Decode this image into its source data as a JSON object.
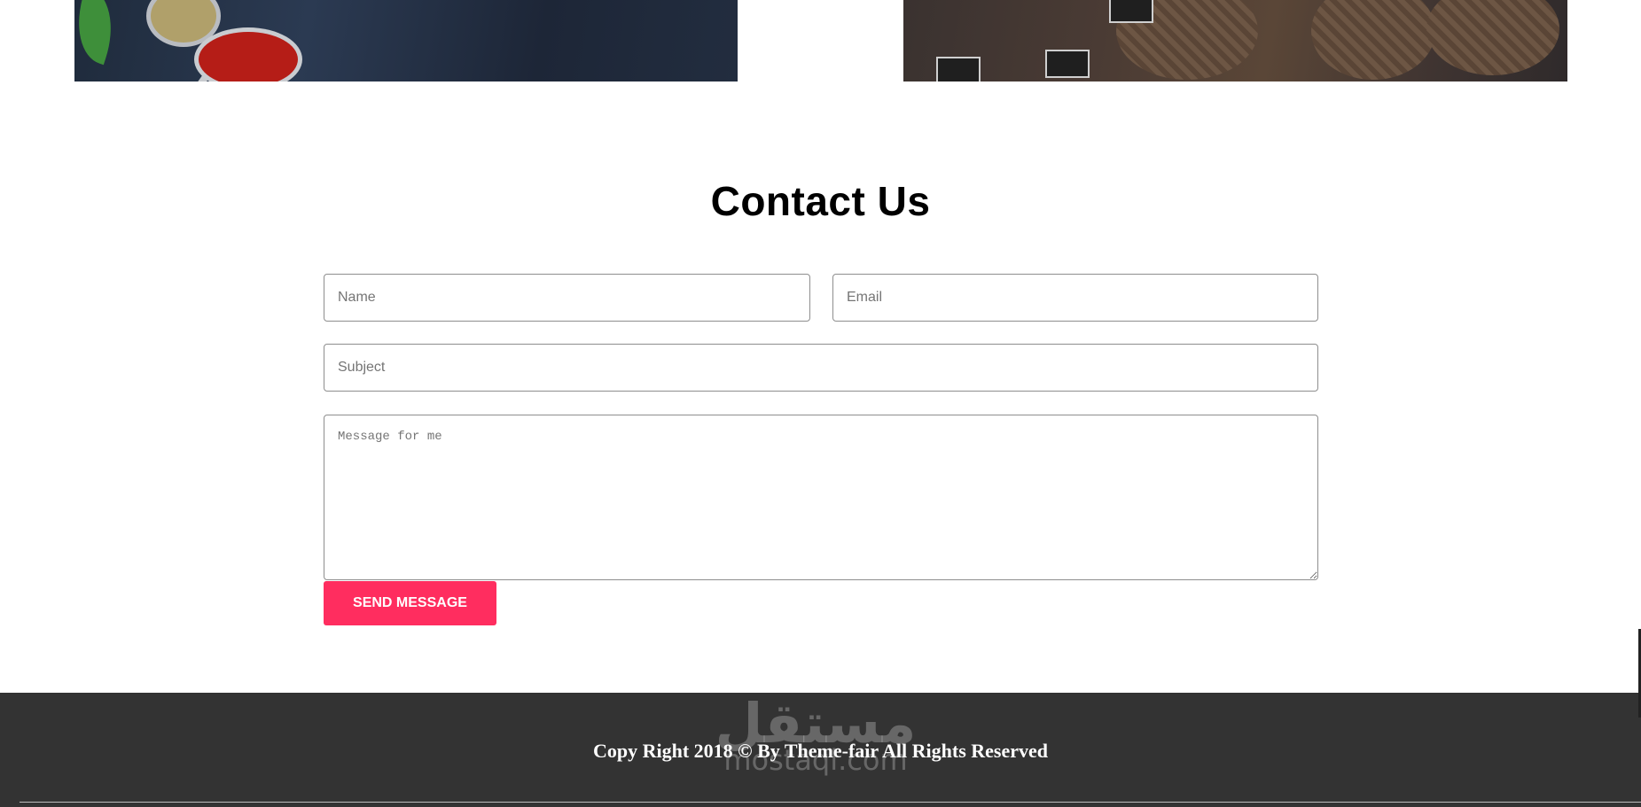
{
  "gallery": {
    "left_image": "spices-on-spoons-image",
    "right_image": "bread-baskets-image"
  },
  "contact": {
    "title": "Contact Us",
    "name_placeholder": "Name",
    "email_placeholder": "Email",
    "subject_placeholder": "Subject",
    "message_placeholder": "Message for me",
    "send_label": "SEND MESSAGE",
    "send_color": "#ff2d5f"
  },
  "footer": {
    "copyright": "Copy Right 2018 © By Theme-fair All Rights Reserved",
    "background": "#333333"
  },
  "watermark": {
    "arabic": "مستقل",
    "latin": "mostaql.com"
  }
}
